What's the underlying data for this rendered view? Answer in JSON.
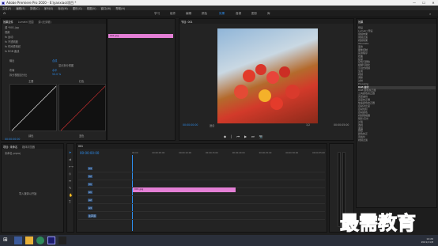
{
  "app": {
    "title": "Adobe Premiere Pro 2020 - E:\\yanxiao\\项目 *"
  },
  "window_controls": [
    "—",
    "☐",
    "✕"
  ],
  "menu": [
    "文件(F)",
    "编辑(E)",
    "剪辑(C)",
    "序列(S)",
    "标记(M)",
    "图形(G)",
    "视图(V)",
    "窗口(W)",
    "帮助(H)"
  ],
  "workspaces": [
    "学习",
    "组件",
    "编辑",
    "颜色",
    "效果",
    "音频",
    "图形",
    "库"
  ],
  "workspace_active": "效果",
  "effect_controls": {
    "tabs": [
      "效果控件",
      "Lumetri 范围",
      "源:(无剪辑)",
      "音频剪辑混合器",
      "项目"
    ],
    "clip_label": "源 *001.jpg",
    "seq_label": "001.jpg",
    "rows": [
      "视频",
      "fx 运动",
      "fx 不透明度",
      "fx 时间重映射",
      "fx RGB 曲线",
      "输出",
      "主要",
      "显示拆分视图",
      "布局",
      "拆分视图百分比"
    ],
    "values": {
      "output": "合成",
      "layout": "水平",
      "split_pct": "50.0 %"
    },
    "curve_labels": {
      "master": "主要",
      "red": "红色",
      "green": "绿色",
      "blue": "蓝色"
    },
    "timecode": "00:00:00:00"
  },
  "clip_bar_label": "001.jpg",
  "program_monitor": {
    "title": "节目: 001",
    "timecode_left": "00:00:00:00",
    "fit": "适合",
    "quality": "完整",
    "timecode_right": "00:00:05:00",
    "ratio": "1/2"
  },
  "effects_panel": {
    "title": "效果",
    "items": [
      "预设",
      "Lumetri 预设",
      "音频效果",
      "音频过渡",
      "视频效果",
      "Obsolete",
      "变换",
      "图像控制",
      "实用程序",
      "扭曲",
      "时间",
      "杂色与颗粒",
      "模糊与锐化",
      "沉浸式视频",
      "生成",
      "视频",
      "调整",
      "过时",
      "ProcAmp",
      "RGB 曲线",
      "RGB 颜色校正器",
      "三向颜色校正器",
      "亮度曲线",
      "亮度校正器",
      "快速颜色校正器",
      "自动对比度",
      "自动色阶",
      "自动颜色",
      "视频限幅器",
      "阴影/高光",
      "过渡",
      "透视",
      "通道",
      "键控",
      "颜色校正",
      "风格化",
      "视频过渡"
    ],
    "highlight": "RGB 曲线"
  },
  "project_panel": {
    "tabs": [
      "项目: 未命名",
      "媒体浏览器"
    ],
    "file": "未命名.prproj",
    "empty": "导入媒体以开始"
  },
  "timeline": {
    "title": "001",
    "timecode": "00:00:00:00",
    "tracks": [
      "V3",
      "V2",
      "V1",
      "A1",
      "A2",
      "A3",
      "主声道"
    ],
    "master_val": "0.0",
    "clip": "001.jpg",
    "ruler": [
      "00:00",
      "00:00:05:00",
      "00:00:10:00",
      "00:00:15:00",
      "00:00:20:00",
      "00:00:25:00",
      "00:00:30:00",
      "00:00:35:00"
    ]
  },
  "watermark": {
    "text": "最需教育"
  },
  "taskbar": {
    "time": "14:26",
    "date": "2021/11/8"
  },
  "colors": {
    "accent": "#2d8ceb",
    "clip": "#e37fd5",
    "selection": "#e37fd5",
    "bg": "#1d1d1d"
  }
}
